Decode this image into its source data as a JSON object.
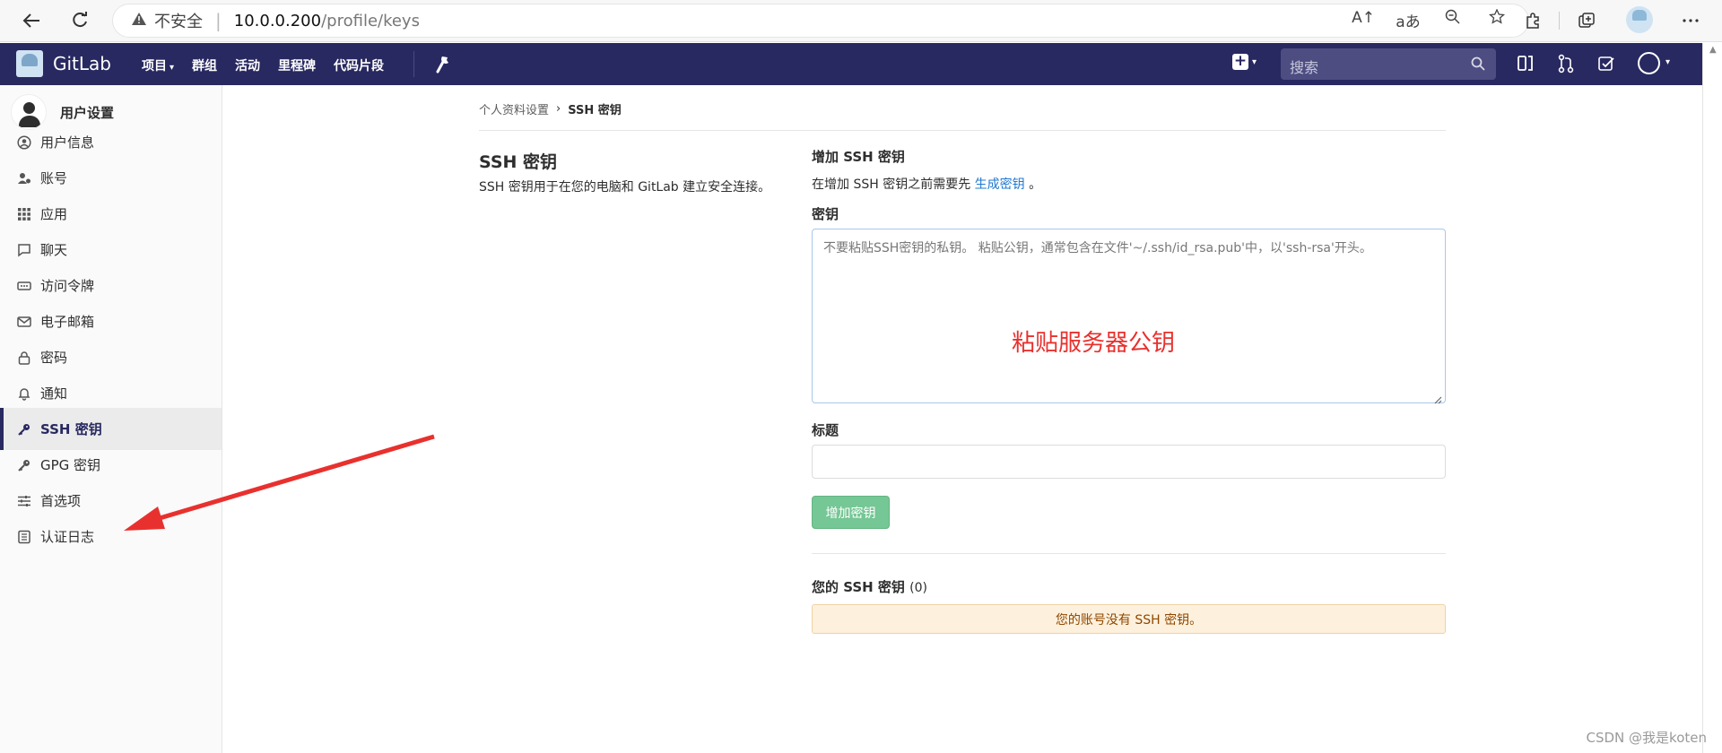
{
  "browser": {
    "insecure_label": "不安全",
    "url_host": "10.0.0.200",
    "url_path": "/profile/keys",
    "read_aloud_glyph": "A↑",
    "translate_glyph": "aあ"
  },
  "header": {
    "brand": "GitLab",
    "nav": [
      "项目",
      "群组",
      "活动",
      "里程碑",
      "代码片段"
    ],
    "search_placeholder": "搜索",
    "bg_color": "#292961"
  },
  "sidebar": {
    "title": "用户设置",
    "items": [
      {
        "label": "用户信息",
        "icon": "user-circle-icon"
      },
      {
        "label": "账号",
        "icon": "account-icon"
      },
      {
        "label": "应用",
        "icon": "grid-icon"
      },
      {
        "label": "聊天",
        "icon": "chat-icon"
      },
      {
        "label": "访问令牌",
        "icon": "token-icon"
      },
      {
        "label": "电子邮箱",
        "icon": "mail-icon"
      },
      {
        "label": "密码",
        "icon": "lock-icon"
      },
      {
        "label": "通知",
        "icon": "bell-icon"
      },
      {
        "label": "SSH 密钥",
        "icon": "key-icon",
        "active": true
      },
      {
        "label": "GPG 密钥",
        "icon": "key-icon"
      },
      {
        "label": "首选项",
        "icon": "sliders-icon"
      },
      {
        "label": "认证日志",
        "icon": "log-icon"
      }
    ]
  },
  "breadcrumb": {
    "parent": "个人资料设置",
    "separator": "›",
    "current": "SSH 密钥"
  },
  "main": {
    "left_title": "SSH 密钥",
    "left_desc": "SSH 密钥用于在您的电脑和 GitLab 建立安全连接。",
    "add_title": "增加 SSH 密钥",
    "add_hint_prefix": "在增加 SSH 密钥之前需要先",
    "add_hint_link": "生成密钥",
    "add_hint_suffix": "。",
    "key_label": "密钥",
    "key_placeholder": "不要粘贴SSH密钥的私钥。 粘贴公钥，通常包含在文件'~/.ssh/id_rsa.pub'中，以'ssh-rsa'开头。",
    "key_annotation": "粘贴服务器公钥",
    "title_label": "标题",
    "title_value": "",
    "add_button": "增加密钥",
    "your_keys_title": "您的 SSH 密钥",
    "your_keys_count": "(0)",
    "empty_message": "您的账号没有 SSH 密钥。"
  },
  "watermark": "CSDN @我是koten"
}
